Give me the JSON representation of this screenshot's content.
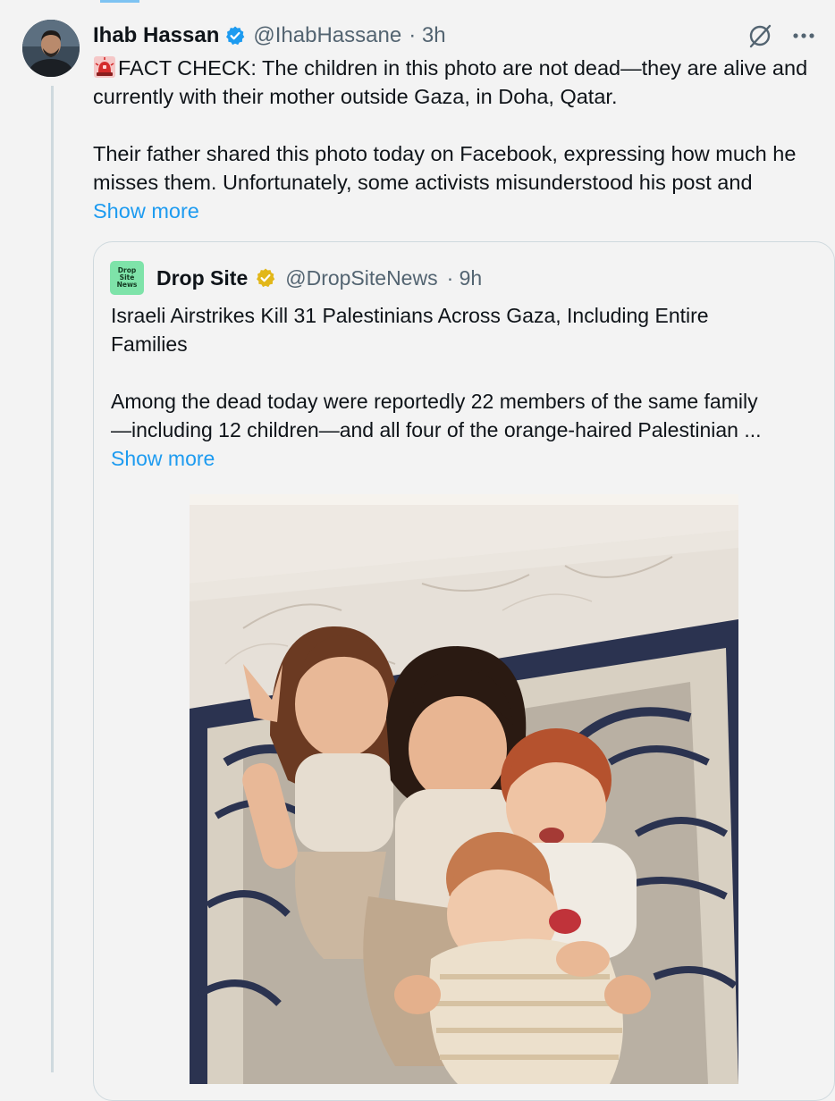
{
  "tweet": {
    "author": {
      "name": "Ihab Hassan",
      "handle": "@IhabHassane",
      "time": "· 3h",
      "verified": true
    },
    "icons": [
      "siren-emoji",
      "grok-icon",
      "more-icon",
      "verified-badge-icon"
    ],
    "text_lines": [
      "FACT CHECK: The children in this photo are not dead—they are alive and",
      "currently with their mother outside Gaza, in Doha, Qatar.",
      "",
      "Their father shared this photo today on Facebook, expressing how much he",
      "misses them. Unfortunately, some activists misunderstood his post and"
    ],
    "show_more": "Show more"
  },
  "quote": {
    "author": {
      "name": "Drop Site",
      "handle": "@DropSiteNews",
      "time": "· 9h",
      "logo_lines": [
        "Drop",
        "Site",
        "News"
      ],
      "verified": "gold"
    },
    "text_lines": [
      "Israeli Airstrikes Kill 31 Palestinians Across Gaza, Including Entire",
      "Families",
      "",
      "Among the dead today were reportedly 22 members of the same family",
      "—including 12 children—and all four of the orange-haired Palestinian ..."
    ],
    "show_more": "Show more",
    "media": "photo of four children sitting together on a patterned rug"
  },
  "colors": {
    "link": "#1d9bf0",
    "secondary_text": "#536471",
    "border": "#cfd9de",
    "verified_blue": "#1d9bf0",
    "verified_gold": "#e2b719",
    "background": "#f3f3f3"
  }
}
